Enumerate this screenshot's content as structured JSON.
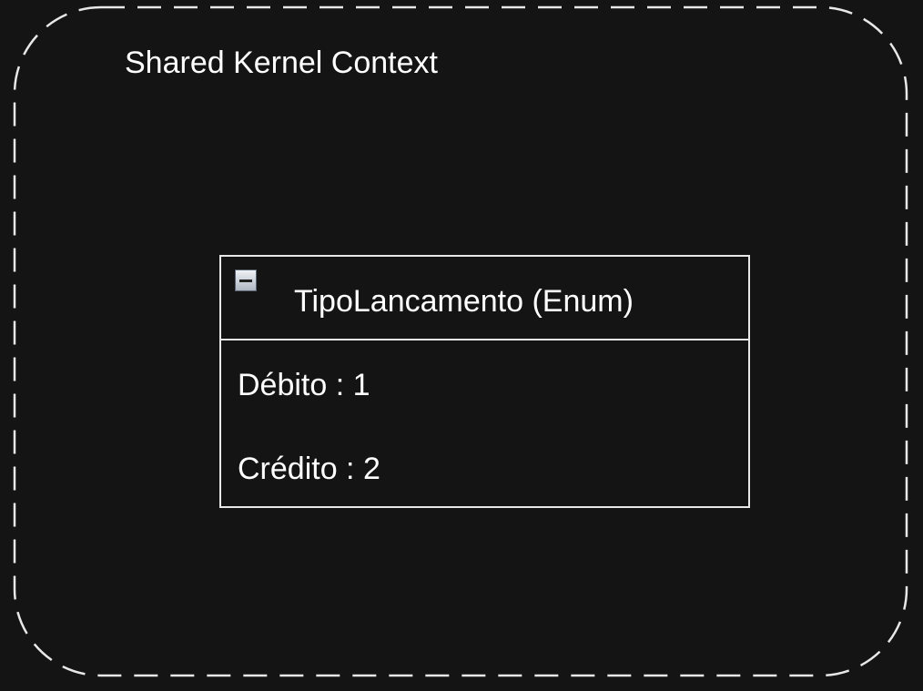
{
  "context": {
    "title": "Shared Kernel Context"
  },
  "enum": {
    "title": "TipoLancamento (Enum)",
    "values": [
      "Débito : 1",
      "Crédito : 2"
    ]
  },
  "colors": {
    "background": "#141414",
    "stroke": "#e8e8e8",
    "text": "#ffffff"
  },
  "icons": {
    "collapse": "minus-square-icon"
  }
}
